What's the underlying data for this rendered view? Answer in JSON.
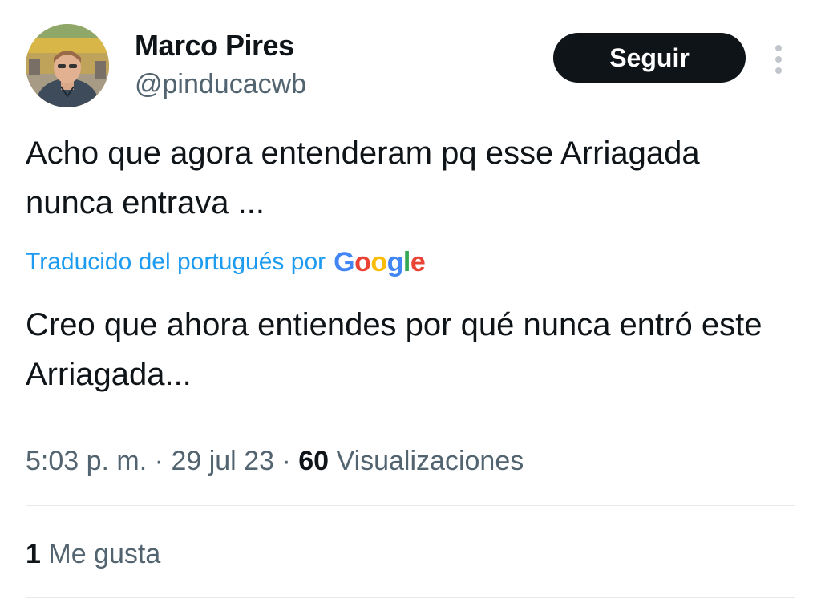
{
  "author": {
    "name": "Marco Pires",
    "handle": "@pinducacwb",
    "avatar_icon": "profile-photo"
  },
  "actions": {
    "follow_label": "Seguir",
    "more_icon": "vertical-ellipsis-icon"
  },
  "tweet": {
    "original_text": "Acho que agora entenderam pq esse Arriagada nunca entrava ...",
    "translation_label": "Traducido del portugués por",
    "translation_provider": "Google",
    "translated_text": "Creo que ahora entiendes por qué nunca entró este Arriagada..."
  },
  "meta": {
    "time": "5:03 p. m.",
    "separator": "·",
    "date": "29 jul 23",
    "views_count": "60",
    "views_label": "Visualizaciones"
  },
  "stats": {
    "likes_count": "1",
    "likes_label": "Me gusta"
  },
  "colors": {
    "text": "#0f1419",
    "secondary": "#536471",
    "link": "#1d9bf0",
    "button_bg": "#0f1419",
    "divider": "#e6e9eb"
  }
}
